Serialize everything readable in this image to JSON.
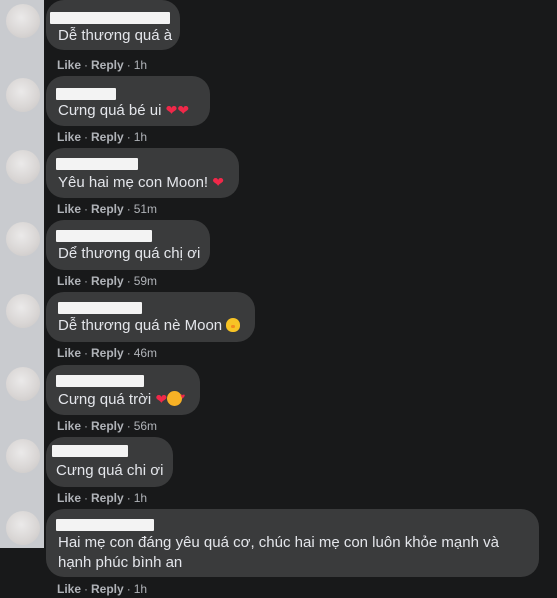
{
  "actions": {
    "like": "Like",
    "reply": "Reply",
    "separator": "·"
  },
  "comments": [
    {
      "text": "Dễ thương quá à",
      "time": "1h"
    },
    {
      "text": "Cưng quá bé ui",
      "time": "1h"
    },
    {
      "text": "Yêu hai mẹ con Moon!",
      "time": "51m"
    },
    {
      "text": "Dể thương quá chị ơi",
      "time": "59m"
    },
    {
      "text": "Dễ thương quá nè Moon",
      "time": "46m"
    },
    {
      "text": "Cưng quá trời",
      "time": "56m"
    },
    {
      "text": "Cưng quá chi ơi",
      "time": "1h"
    },
    {
      "text_line1": "Hai mẹ con đáng yêu quá cơ, chúc hai mẹ con luôn khỏe mạnh và",
      "text_line2": "hạnh phúc bình an",
      "time": "1h"
    }
  ],
  "colors": {
    "background": "#18191a",
    "bubble": "#3a3b3c",
    "text": "#e4e6eb",
    "meta": "#b0b3b8",
    "heart": "#f02849"
  }
}
